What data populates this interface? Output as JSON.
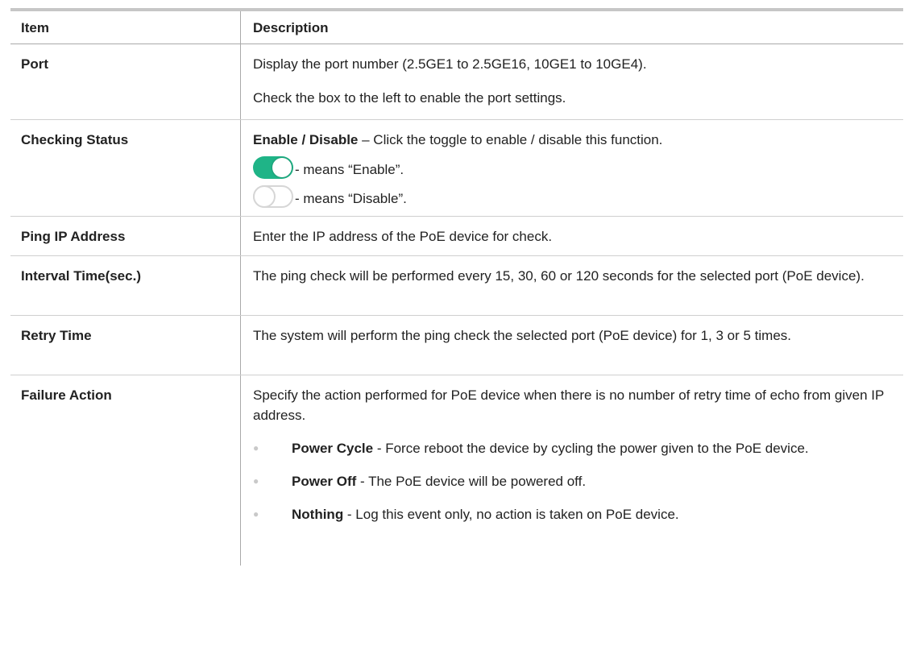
{
  "header": {
    "item": "Item",
    "description": "Description"
  },
  "rows": {
    "port": {
      "item": "Port",
      "line1": "Display the port number (2.5GE1 to 2.5GE16, 10GE1 to 10GE4).",
      "line2": "Check the box to the left to enable the port settings."
    },
    "checking_status": {
      "item": "Checking Status",
      "term": "Enable / Disable",
      "text": " – Click the toggle to enable / disable this function.",
      "enable_text": " - means “Enable”.",
      "disable_text": " - means “Disable”.",
      "enable_icon": "toggle-on-icon",
      "disable_icon": "toggle-off-icon",
      "toggle_on_color": "#1fb487"
    },
    "ping_ip": {
      "item": "Ping IP Address",
      "text": "Enter the IP address of the PoE device for check."
    },
    "interval": {
      "item": "Interval Time(sec.)",
      "text": "The ping check will be performed every 15, 30, 60 or 120 seconds for the selected port (PoE device)."
    },
    "retry": {
      "item": "Retry Time",
      "text": "The system will perform the ping check the selected port (PoE device) for 1, 3 or 5 times."
    },
    "failure": {
      "item": "Failure Action",
      "text": "Specify the action performed for PoE device when there is no number of retry time of echo from given IP address.",
      "bullets": [
        {
          "term": "Power Cycle",
          "text": " - Force reboot the device by cycling the power given to the PoE device."
        },
        {
          "term": "Power Off",
          "text": " - The PoE device will be powered off."
        },
        {
          "term": "Nothing",
          "text": " - Log this event only, no action is taken on PoE device."
        }
      ]
    }
  }
}
